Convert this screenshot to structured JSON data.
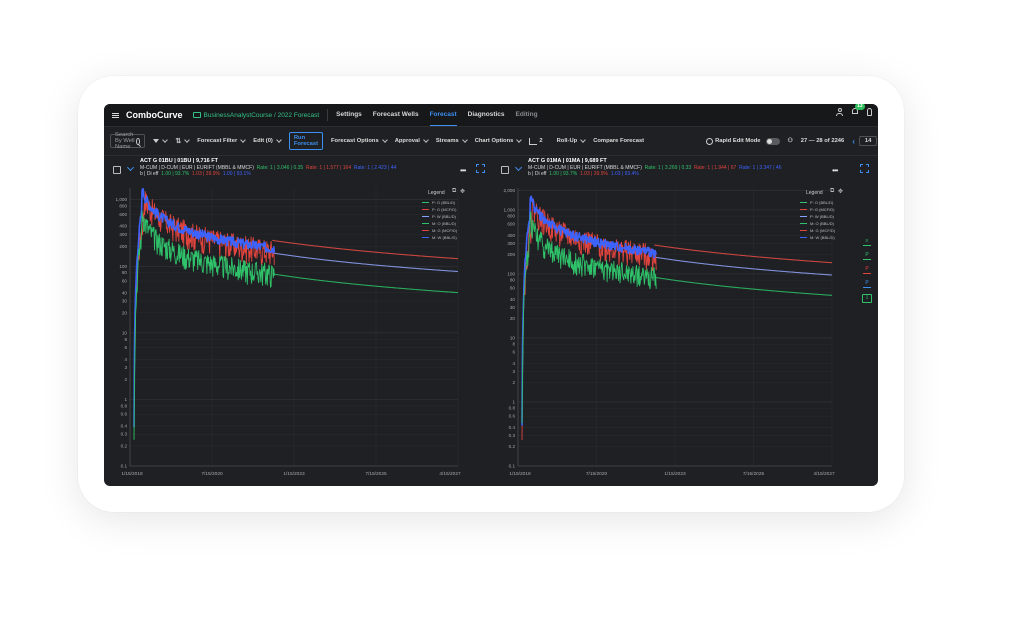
{
  "app": {
    "brand": "ComboCurve",
    "project_path": "BusinessAnalystCourse / 2022 Forecast"
  },
  "nav": [
    "Settings",
    "Forecast Wells",
    "Forecast",
    "Diagnostics",
    "Editing"
  ],
  "nav_active": "Forecast",
  "notifications_count": "13",
  "toolbar": {
    "search_placeholder": "Search By Well Name",
    "forecast_filter": "Forecast Filter",
    "edit": "Edit (0)",
    "run_forecast": "Run Forecast",
    "forecast_options": "Forecast Options",
    "approval": "Approval",
    "streams": "Streams",
    "chart_options": "Chart Options",
    "charts_count": "2",
    "roll_up": "Roll-Up",
    "compare_forecast": "Compare Forecast",
    "rapid_edit_mode": "Rapid Edit Mode",
    "page_range": "27 — 28 of 2246",
    "page_input": "14"
  },
  "panels": [
    {
      "title": "ACT G 01BU | 01BU | 9,716 FT",
      "line2": "M-CUM | D-CUM | EUR | EURIFT (MBBL & MMCF)",
      "line2_green": "Rate: 1 | 3.046 | 0.35",
      "line2_red": "Rate: 1 | 1.577 | 164",
      "line2_blue": "Rate: 1 | 2.423 | 44",
      "line3": "b | Di eff",
      "line3_green": "1.00 | 93.7%",
      "line3_red": "1.03 | 39.9%",
      "line3_blue": "1.00 | 93.1%",
      "x_ticks": [
        "1/15/2018",
        "7/15/2020",
        "1/15/2023",
        "7/15/2025",
        "4/15/2027"
      ],
      "y_ticks": [
        "1,000",
        "800",
        "600",
        "400",
        "300",
        "200",
        "100",
        "80",
        "60",
        "40",
        "30",
        "20",
        "10",
        "8",
        "6",
        "4",
        "3",
        "2",
        "1",
        "0.8",
        "0.6",
        "0.4",
        "0.3",
        "0.2",
        "0.1"
      ]
    },
    {
      "title": "ACT G 01MA | 01MA | 9,689 FT",
      "line2": "M-CUM | D-CUM | EUR | EURIFT (MBBL & MMCF)",
      "line2_green": "Rate: 1 | 3.269 | 0.33",
      "line2_red": "Rate: 1 | 1.944 | 67",
      "line2_blue": "Rate: 1 | 3.347 | 46",
      "line3": "b | Di eff",
      "line3_green": "1.00 | 93.7%",
      "line3_red": "1.03 | 39.9%",
      "line3_blue": "1.03 | 93.4%",
      "x_ticks": [
        "1/15/2018",
        "7/15/2020",
        "1/15/2023",
        "7/15/2025",
        "4/15/2027"
      ],
      "y_ticks": [
        "2,000",
        "1,000",
        "800",
        "600",
        "400",
        "300",
        "200",
        "100",
        "80",
        "60",
        "40",
        "30",
        "20",
        "10",
        "8",
        "6",
        "4",
        "3",
        "2",
        "1",
        "0.8",
        "0.6",
        "0.4",
        "0.3",
        "0.2",
        "0.1"
      ]
    }
  ],
  "legend": {
    "title": "Legend",
    "items": [
      {
        "label": "P: O (BBL/D)",
        "color": "#2fc26a"
      },
      {
        "label": "P: G (MCF/D)",
        "color": "#e0443e"
      },
      {
        "label": "P: W (BBL/D)",
        "color": "#8aa0ff"
      },
      {
        "label": "M: O (BBL/D)",
        "color": "#2fc26a"
      },
      {
        "label": "M: G (MCF/D)",
        "color": "#e0443e"
      },
      {
        "label": "M: W (BBL/D)",
        "color": "#3d63ff"
      }
    ]
  },
  "colors": {
    "oil": "#2fc26a",
    "gas": "#e0443e",
    "water": "#3d63ff",
    "water_forecast": "#7f8fd8",
    "accent": "#3d8ff0"
  }
}
